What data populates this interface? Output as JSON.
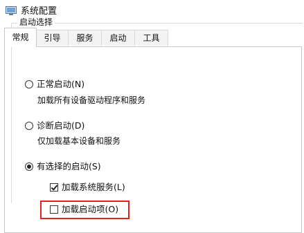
{
  "window": {
    "title": "系统配置",
    "icon": "system-config-icon"
  },
  "tabs": [
    {
      "label": "常规",
      "active": true
    },
    {
      "label": "引导",
      "active": false
    },
    {
      "label": "服务",
      "active": false
    },
    {
      "label": "启动",
      "active": false
    },
    {
      "label": "工具",
      "active": false
    }
  ],
  "startup_selection": {
    "group_title": "启动选择",
    "normal": {
      "label": "正常启动(N)",
      "description": "加载所有设备驱动程序和服务",
      "selected": false
    },
    "diagnostic": {
      "label": "诊断启动(D)",
      "description": "仅加载基本设备和服务",
      "selected": false
    },
    "selective": {
      "label": "有选择的启动(S)",
      "selected": true,
      "load_system_services": {
        "label": "加载系统服务(L)",
        "checked": true
      },
      "load_startup_items": {
        "label": "加载启动项(O)",
        "checked": false
      }
    }
  },
  "colors": {
    "highlight": "#e2231a"
  }
}
